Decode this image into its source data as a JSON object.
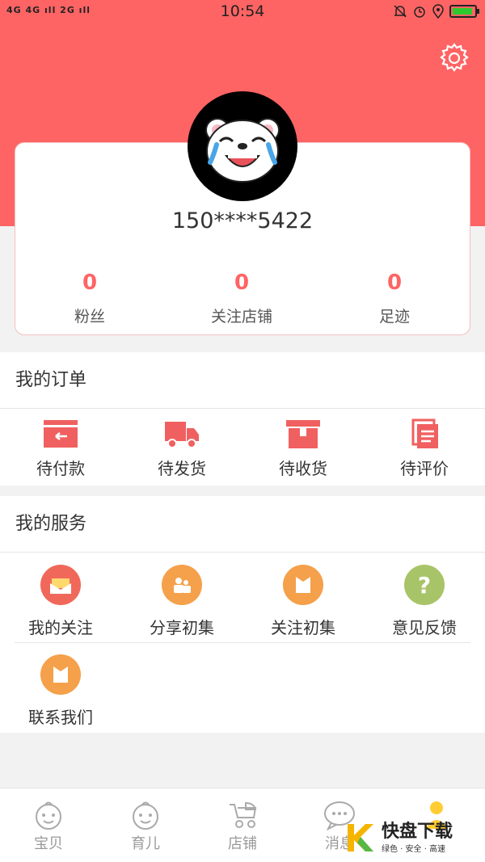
{
  "status_bar": {
    "signal_text": "4G 4G ıll 2G ıll",
    "time": "10:54"
  },
  "profile": {
    "phone": "150****5422",
    "stats": [
      {
        "value": "0",
        "label": "粉丝"
      },
      {
        "value": "0",
        "label": "关注店铺"
      },
      {
        "value": "0",
        "label": "足迹"
      }
    ]
  },
  "orders": {
    "title": "我的订单",
    "items": [
      {
        "label": "待付款",
        "icon": "wallet-icon"
      },
      {
        "label": "待发货",
        "icon": "truck-icon"
      },
      {
        "label": "待收货",
        "icon": "box-icon"
      },
      {
        "label": "待评价",
        "icon": "document-icon"
      }
    ]
  },
  "services": {
    "title": "我的服务",
    "items": [
      {
        "label": "我的关注",
        "icon": "mail-icon",
        "color": "#f0685a"
      },
      {
        "label": "分享初集",
        "icon": "people-icon",
        "color": "#f5a04a"
      },
      {
        "label": "关注初集",
        "icon": "envelope-icon",
        "color": "#f5a04a"
      },
      {
        "label": "意见反馈",
        "icon": "question-icon",
        "color": "#a8c468"
      },
      {
        "label": "联系我们",
        "icon": "envelope-icon",
        "color": "#f5a04a"
      }
    ]
  },
  "tabbar": {
    "items": [
      {
        "label": "宝贝",
        "icon": "baby-face-icon"
      },
      {
        "label": "育儿",
        "icon": "baby-face-icon"
      },
      {
        "label": "店铺",
        "icon": "stroller-icon"
      },
      {
        "label": "消息",
        "icon": "chat-bubble-icon"
      }
    ]
  },
  "watermark": {
    "brand": "快盘下载",
    "tagline": "绿色 · 安全 · 高速"
  },
  "colors": {
    "accent": "#ff6464",
    "order_icon": "#f06060"
  }
}
